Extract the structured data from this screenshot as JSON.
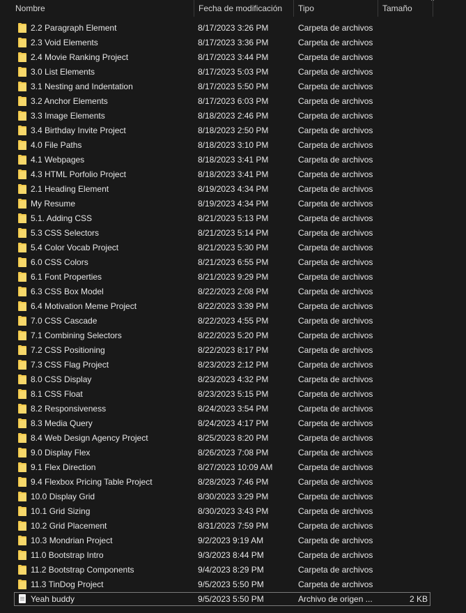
{
  "header": {
    "name": "Nombre",
    "date": "Fecha de modificación",
    "type": "Tipo",
    "size": "Tamaño"
  },
  "rows": [
    {
      "name": "2.2 Paragraph Element",
      "date": "8/17/2023 3:26 PM",
      "type": "Carpeta de archivos",
      "size": "",
      "icon": "folder-icon"
    },
    {
      "name": "2.3 Void Elements",
      "date": "8/17/2023 3:36 PM",
      "type": "Carpeta de archivos",
      "size": "",
      "icon": "folder-icon"
    },
    {
      "name": "2.4 Movie Ranking Project",
      "date": "8/17/2023 3:44 PM",
      "type": "Carpeta de archivos",
      "size": "",
      "icon": "folder-icon"
    },
    {
      "name": "3.0 List Elements",
      "date": "8/17/2023 5:03 PM",
      "type": "Carpeta de archivos",
      "size": "",
      "icon": "folder-icon"
    },
    {
      "name": "3.1 Nesting and Indentation",
      "date": "8/17/2023 5:50 PM",
      "type": "Carpeta de archivos",
      "size": "",
      "icon": "folder-icon"
    },
    {
      "name": "3.2 Anchor Elements",
      "date": "8/17/2023 6:03 PM",
      "type": "Carpeta de archivos",
      "size": "",
      "icon": "folder-icon"
    },
    {
      "name": "3.3 Image Elements",
      "date": "8/18/2023 2:46 PM",
      "type": "Carpeta de archivos",
      "size": "",
      "icon": "folder-icon"
    },
    {
      "name": "3.4 Birthday Invite Project",
      "date": "8/18/2023 2:50 PM",
      "type": "Carpeta de archivos",
      "size": "",
      "icon": "folder-icon"
    },
    {
      "name": "4.0 File Paths",
      "date": "8/18/2023 3:10 PM",
      "type": "Carpeta de archivos",
      "size": "",
      "icon": "folder-icon"
    },
    {
      "name": "4.1 Webpages",
      "date": "8/18/2023 3:41 PM",
      "type": "Carpeta de archivos",
      "size": "",
      "icon": "folder-icon"
    },
    {
      "name": "4.3 HTML Porfolio Project",
      "date": "8/18/2023 3:41 PM",
      "type": "Carpeta de archivos",
      "size": "",
      "icon": "folder-icon"
    },
    {
      "name": "2.1 Heading Element",
      "date": "8/19/2023 4:34 PM",
      "type": "Carpeta de archivos",
      "size": "",
      "icon": "folder-icon"
    },
    {
      "name": "My Resume",
      "date": "8/19/2023 4:34 PM",
      "type": "Carpeta de archivos",
      "size": "",
      "icon": "folder-icon"
    },
    {
      "name": "5.1. Adding CSS",
      "date": "8/21/2023 5:13 PM",
      "type": "Carpeta de archivos",
      "size": "",
      "icon": "folder-icon"
    },
    {
      "name": "5.3 CSS Selectors",
      "date": "8/21/2023 5:14 PM",
      "type": "Carpeta de archivos",
      "size": "",
      "icon": "folder-icon"
    },
    {
      "name": "5.4 Color Vocab Project",
      "date": "8/21/2023 5:30 PM",
      "type": "Carpeta de archivos",
      "size": "",
      "icon": "folder-icon"
    },
    {
      "name": "6.0 CSS Colors",
      "date": "8/21/2023 6:55 PM",
      "type": "Carpeta de archivos",
      "size": "",
      "icon": "folder-icon"
    },
    {
      "name": "6.1 Font Properties",
      "date": "8/21/2023 9:29 PM",
      "type": "Carpeta de archivos",
      "size": "",
      "icon": "folder-icon"
    },
    {
      "name": "6.3 CSS Box Model",
      "date": "8/22/2023 2:08 PM",
      "type": "Carpeta de archivos",
      "size": "",
      "icon": "folder-icon"
    },
    {
      "name": "6.4 Motivation Meme Project",
      "date": "8/22/2023 3:39 PM",
      "type": "Carpeta de archivos",
      "size": "",
      "icon": "folder-icon"
    },
    {
      "name": "7.0 CSS Cascade",
      "date": "8/22/2023 4:55 PM",
      "type": "Carpeta de archivos",
      "size": "",
      "icon": "folder-icon"
    },
    {
      "name": "7.1 Combining Selectors",
      "date": "8/22/2023 5:20 PM",
      "type": "Carpeta de archivos",
      "size": "",
      "icon": "folder-icon"
    },
    {
      "name": "7.2 CSS Positioning",
      "date": "8/22/2023 8:17 PM",
      "type": "Carpeta de archivos",
      "size": "",
      "icon": "folder-icon"
    },
    {
      "name": "7.3 CSS Flag Project",
      "date": "8/23/2023 2:12 PM",
      "type": "Carpeta de archivos",
      "size": "",
      "icon": "folder-icon"
    },
    {
      "name": "8.0 CSS Display",
      "date": "8/23/2023 4:32 PM",
      "type": "Carpeta de archivos",
      "size": "",
      "icon": "folder-icon"
    },
    {
      "name": "8.1 CSS Float",
      "date": "8/23/2023 5:15 PM",
      "type": "Carpeta de archivos",
      "size": "",
      "icon": "folder-icon"
    },
    {
      "name": "8.2 Responsiveness",
      "date": "8/24/2023 3:54 PM",
      "type": "Carpeta de archivos",
      "size": "",
      "icon": "folder-icon"
    },
    {
      "name": "8.3 Media Query",
      "date": "8/24/2023 4:17 PM",
      "type": "Carpeta de archivos",
      "size": "",
      "icon": "folder-icon"
    },
    {
      "name": "8.4 Web Design Agency Project",
      "date": "8/25/2023 8:20 PM",
      "type": "Carpeta de archivos",
      "size": "",
      "icon": "folder-icon"
    },
    {
      "name": "9.0 Display Flex",
      "date": "8/26/2023 7:08 PM",
      "type": "Carpeta de archivos",
      "size": "",
      "icon": "folder-icon"
    },
    {
      "name": "9.1 Flex Direction",
      "date": "8/27/2023 10:09 AM",
      "type": "Carpeta de archivos",
      "size": "",
      "icon": "folder-icon"
    },
    {
      "name": "9.4 Flexbox Pricing Table Project",
      "date": "8/28/2023 7:46 PM",
      "type": "Carpeta de archivos",
      "size": "",
      "icon": "folder-icon"
    },
    {
      "name": "10.0 Display Grid",
      "date": "8/30/2023 3:29 PM",
      "type": "Carpeta de archivos",
      "size": "",
      "icon": "folder-icon"
    },
    {
      "name": "10.1 Grid Sizing",
      "date": "8/30/2023 3:43 PM",
      "type": "Carpeta de archivos",
      "size": "",
      "icon": "folder-icon"
    },
    {
      "name": "10.2 Grid Placement",
      "date": "8/31/2023 7:59 PM",
      "type": "Carpeta de archivos",
      "size": "",
      "icon": "folder-icon"
    },
    {
      "name": "10.3 Mondrian Project",
      "date": "9/2/2023 9:19 AM",
      "type": "Carpeta de archivos",
      "size": "",
      "icon": "folder-icon"
    },
    {
      "name": "11.0 Bootstrap Intro",
      "date": "9/3/2023 8:44 PM",
      "type": "Carpeta de archivos",
      "size": "",
      "icon": "folder-icon"
    },
    {
      "name": "11.2 Bootstrap Components",
      "date": "9/4/2023 8:29 PM",
      "type": "Carpeta de archivos",
      "size": "",
      "icon": "folder-icon"
    },
    {
      "name": "11.3 TinDog Project",
      "date": "9/5/2023 5:50 PM",
      "type": "Carpeta de archivos",
      "size": "",
      "icon": "folder-icon"
    },
    {
      "name": "Yeah buddy",
      "date": "9/5/2023 5:50 PM",
      "type": "Archivo de origen ...",
      "size": "2 KB",
      "icon": "file-icon",
      "selected": true
    }
  ]
}
